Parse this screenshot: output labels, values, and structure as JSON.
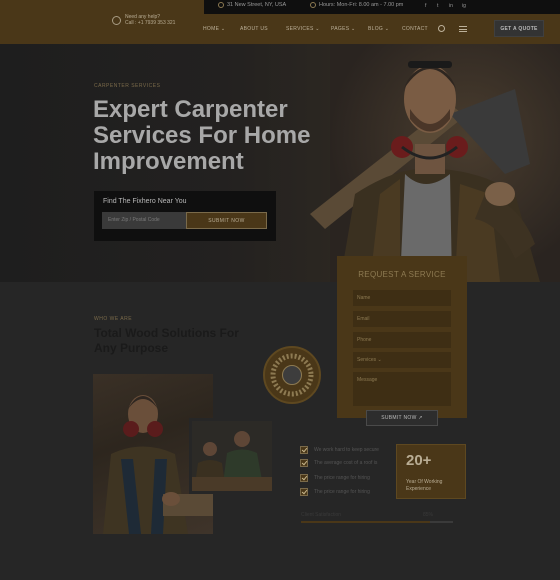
{
  "topbar": {
    "address": "31 New Street, NY, USA",
    "hours": "Hours: Mon-Fri: 8.00 am - 7.00 pm",
    "social": [
      "f",
      "t",
      "in",
      "ig"
    ]
  },
  "header": {
    "logo_line1": "Need any help?",
    "logo_line2": "Call : +1 7939 353 321",
    "nav": [
      "HOME ⌄",
      "ABOUT US",
      "SERVICES ⌄",
      "PAGES ⌄",
      "BLOG ⌄",
      "CONTACT"
    ],
    "quote_button": "GET A QUOTE"
  },
  "hero": {
    "tag": "CARPENTER SERVICES",
    "title": "Expert Carpenter Services For Home Improvement",
    "finder_title": "Find The Fixhero Near You",
    "finder_placeholder": "Enter Zip / Postal Code",
    "finder_button": "SUBMIT NOW"
  },
  "request": {
    "title": "REQUEST A SERVICE",
    "fields": [
      "Name",
      "Email",
      "Phone",
      "Services ⌄",
      "Message"
    ],
    "button": "SUBMIT NOW ↗"
  },
  "about": {
    "tag": "WHO WE ARE",
    "title": "Total Wood Solutions For Any Purpose",
    "checks": [
      "We work hard to keep secure",
      "The average cost of a roof is",
      "The price range for hiring",
      "The price range for hiring"
    ],
    "experience_number": "20+",
    "experience_text": "Year Of Working Experience",
    "satisfaction_label": "Client Satisfaction",
    "satisfaction_value": "85%",
    "satisfaction_fraction": 0.85
  },
  "colors": {
    "accent": "#4a3718",
    "page_bg": "#262626"
  }
}
